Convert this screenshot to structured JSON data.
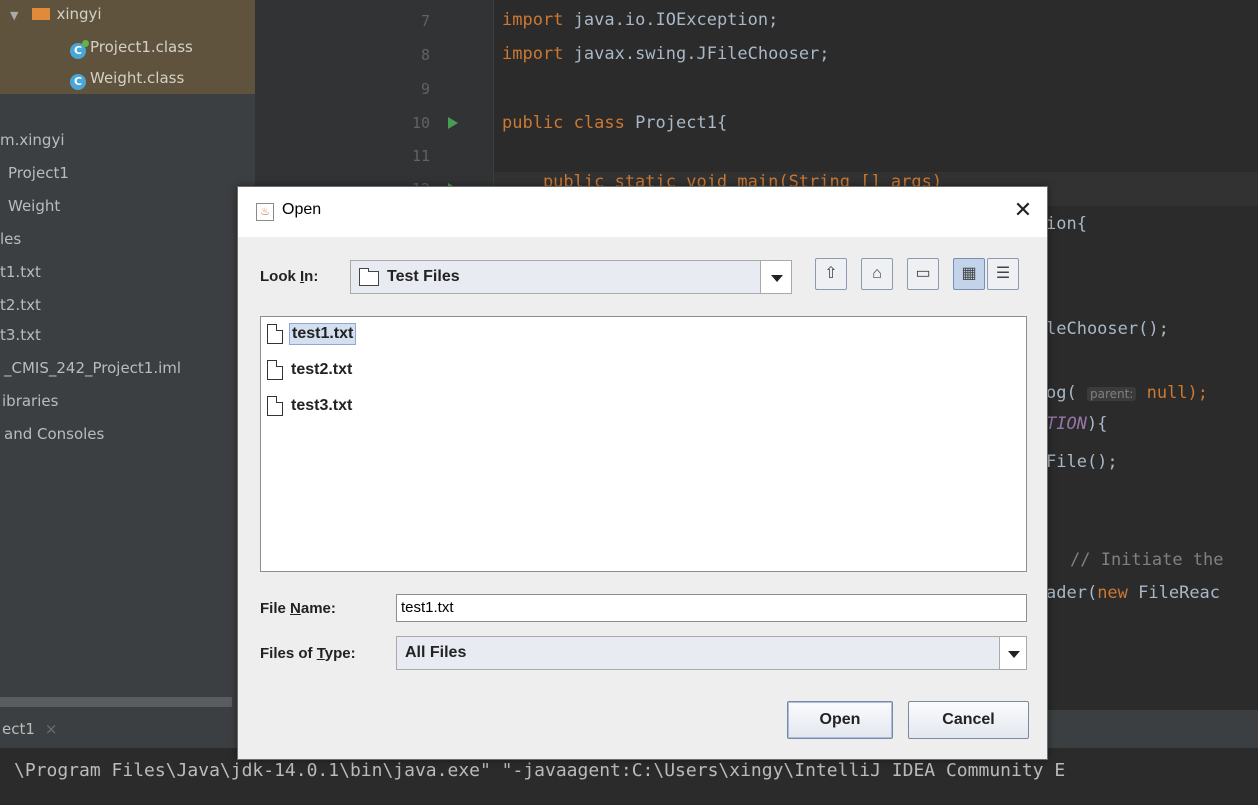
{
  "project_tree": {
    "items": [
      {
        "label": "xingyi"
      },
      {
        "label": "Project1.class"
      },
      {
        "label": "Weight.class"
      },
      {
        "label": "m.xingyi"
      },
      {
        "label": "Project1"
      },
      {
        "label": "Weight"
      },
      {
        "label": "les"
      },
      {
        "label": "t1.txt"
      },
      {
        "label": "t2.txt"
      },
      {
        "label": "t3.txt"
      },
      {
        "label": "_CMIS_242_Project1.iml"
      },
      {
        "label": "ibraries"
      },
      {
        "label": "and Consoles"
      }
    ]
  },
  "editor": {
    "line_numbers": [
      "7",
      "8",
      "9",
      "10",
      "11",
      "12"
    ],
    "lines": {
      "l7_kw": "import",
      "l7_rest": " java.io.IOException;",
      "l8_kw": "import",
      "l8_rest": " javax.swing.JFileChooser;",
      "l10_kw": "public class",
      "l10_rest": " Project1{",
      "l12_text": "    public static void main(String [] args)",
      "r1": "ion{",
      "r2": "leChooser();",
      "r3_pre": "og(",
      "r3_hint": "parent:",
      "r3_post": " null);",
      "r4_it": "TION",
      "r4_post": "){",
      "r5": "File();",
      "r6": "// Initiate the",
      "r7_pre": "ader(",
      "r7_kw": "new",
      "r7_post": " FileReac"
    }
  },
  "run_panel": {
    "tab_label": "ect1",
    "close_icon": "×",
    "command": "\\Program Files\\Java\\jdk-14.0.1\\bin\\java.exe\" \"-javaagent:C:\\Users\\xingy\\IntelliJ IDEA Community E"
  },
  "dialog": {
    "title": "Open",
    "close": "✕",
    "look_in_label_pre": "Look ",
    "look_in_label_u": "I",
    "look_in_label_post": "n:",
    "look_in_value": "Test Files",
    "files": [
      "test1.txt",
      "test2.txt",
      "test3.txt"
    ],
    "file_name_label_pre": "File ",
    "file_name_label_u": "N",
    "file_name_label_post": "ame:",
    "file_name_value": "test1.txt",
    "files_of_type_label_pre": "Files of ",
    "files_of_type_label_u": "T",
    "files_of_type_label_post": "ype:",
    "files_of_type_value": "All Files",
    "open_button": "Open",
    "cancel_button": "Cancel"
  },
  "icons": {
    "toolbar": [
      "up-folder-icon",
      "home-icon",
      "new-folder-icon",
      "list-view-icon",
      "details-view-icon"
    ]
  },
  "colors": {
    "ide_background": "#2b2b2b",
    "keyword": "#cc7832",
    "dialog_background": "#eeeeee"
  }
}
